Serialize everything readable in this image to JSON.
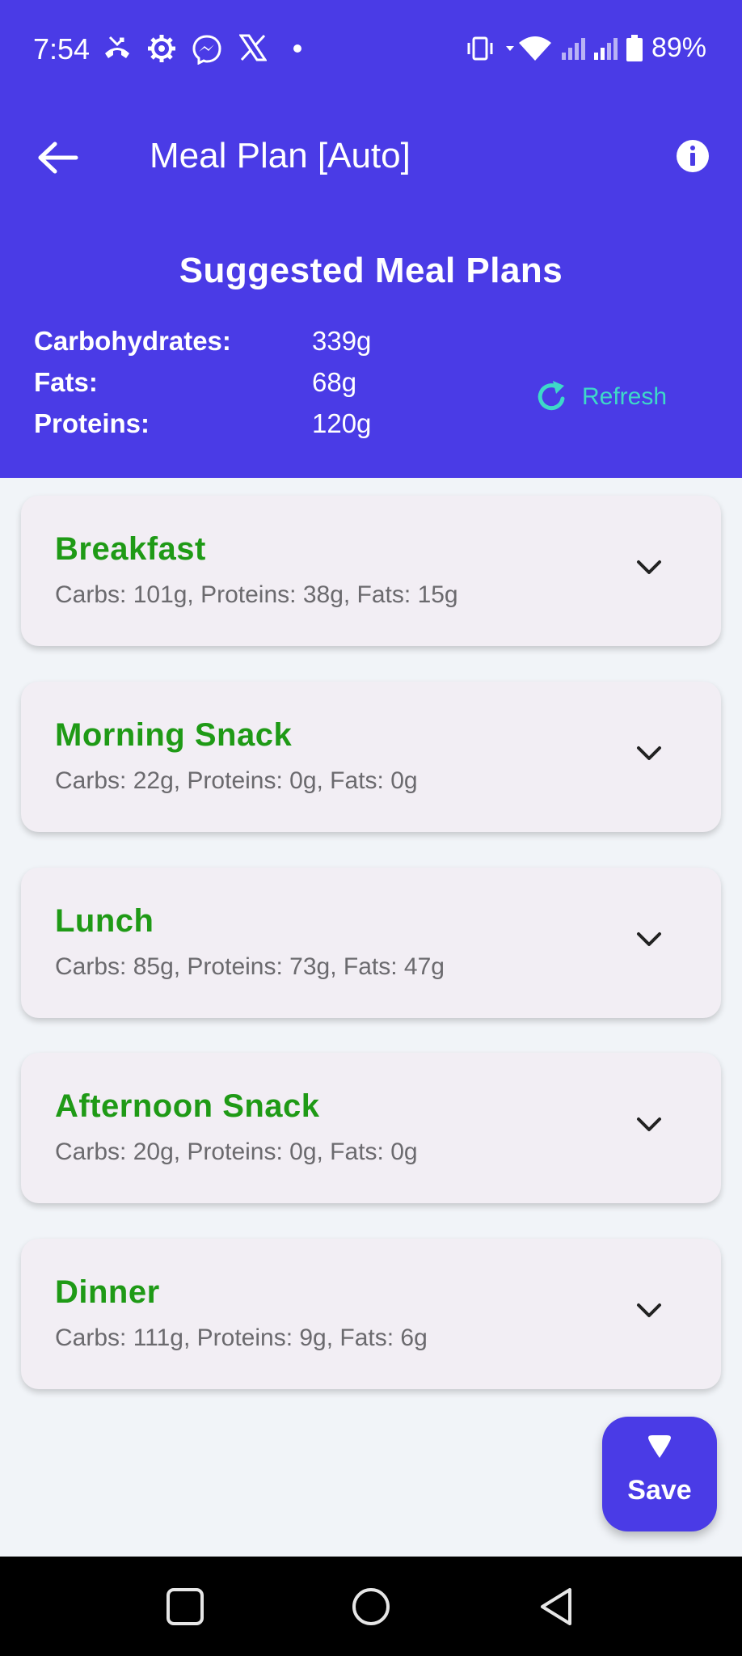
{
  "status_bar": {
    "time": "7:54",
    "battery": "89%",
    "left_icons": [
      "missed-call-icon",
      "settings-gear-icon",
      "messenger-icon",
      "x-logo-icon",
      "dot-icon"
    ],
    "right_icons": [
      "vibrate-icon",
      "wifi-icon",
      "signal-icon",
      "signal-icon",
      "battery-icon"
    ]
  },
  "appbar": {
    "title": "Meal Plan [Auto]",
    "back_icon": "arrow-left-icon",
    "info_icon": "info-icon"
  },
  "summary": {
    "title": "Suggested Meal Plans",
    "macros": [
      {
        "label": "Carbohydrates:",
        "value": "339g"
      },
      {
        "label": "Fats:",
        "value": "68g"
      },
      {
        "label": "Proteins:",
        "value": "120g"
      }
    ],
    "refresh_label": "Refresh"
  },
  "meals": [
    {
      "name": "Breakfast",
      "summary": "Carbs: 101g, Proteins: 38g, Fats: 15g"
    },
    {
      "name": "Morning Snack",
      "summary": "Carbs: 22g, Proteins: 0g, Fats: 0g"
    },
    {
      "name": "Lunch",
      "summary": "Carbs: 85g, Proteins: 73g, Fats: 47g"
    },
    {
      "name": "Afternoon Snack",
      "summary": "Carbs: 20g, Proteins: 0g, Fats: 0g"
    },
    {
      "name": "Dinner",
      "summary": "Carbs: 111g, Proteins: 9g, Fats: 6g"
    }
  ],
  "fab": {
    "label": "Save"
  },
  "colors": {
    "primary": "#4a3be6",
    "meal_title": "#1f9a16",
    "refresh_accent": "#3ed8c8",
    "card_bg": "#f2eef4",
    "page_bg": "#f1f4f8"
  }
}
